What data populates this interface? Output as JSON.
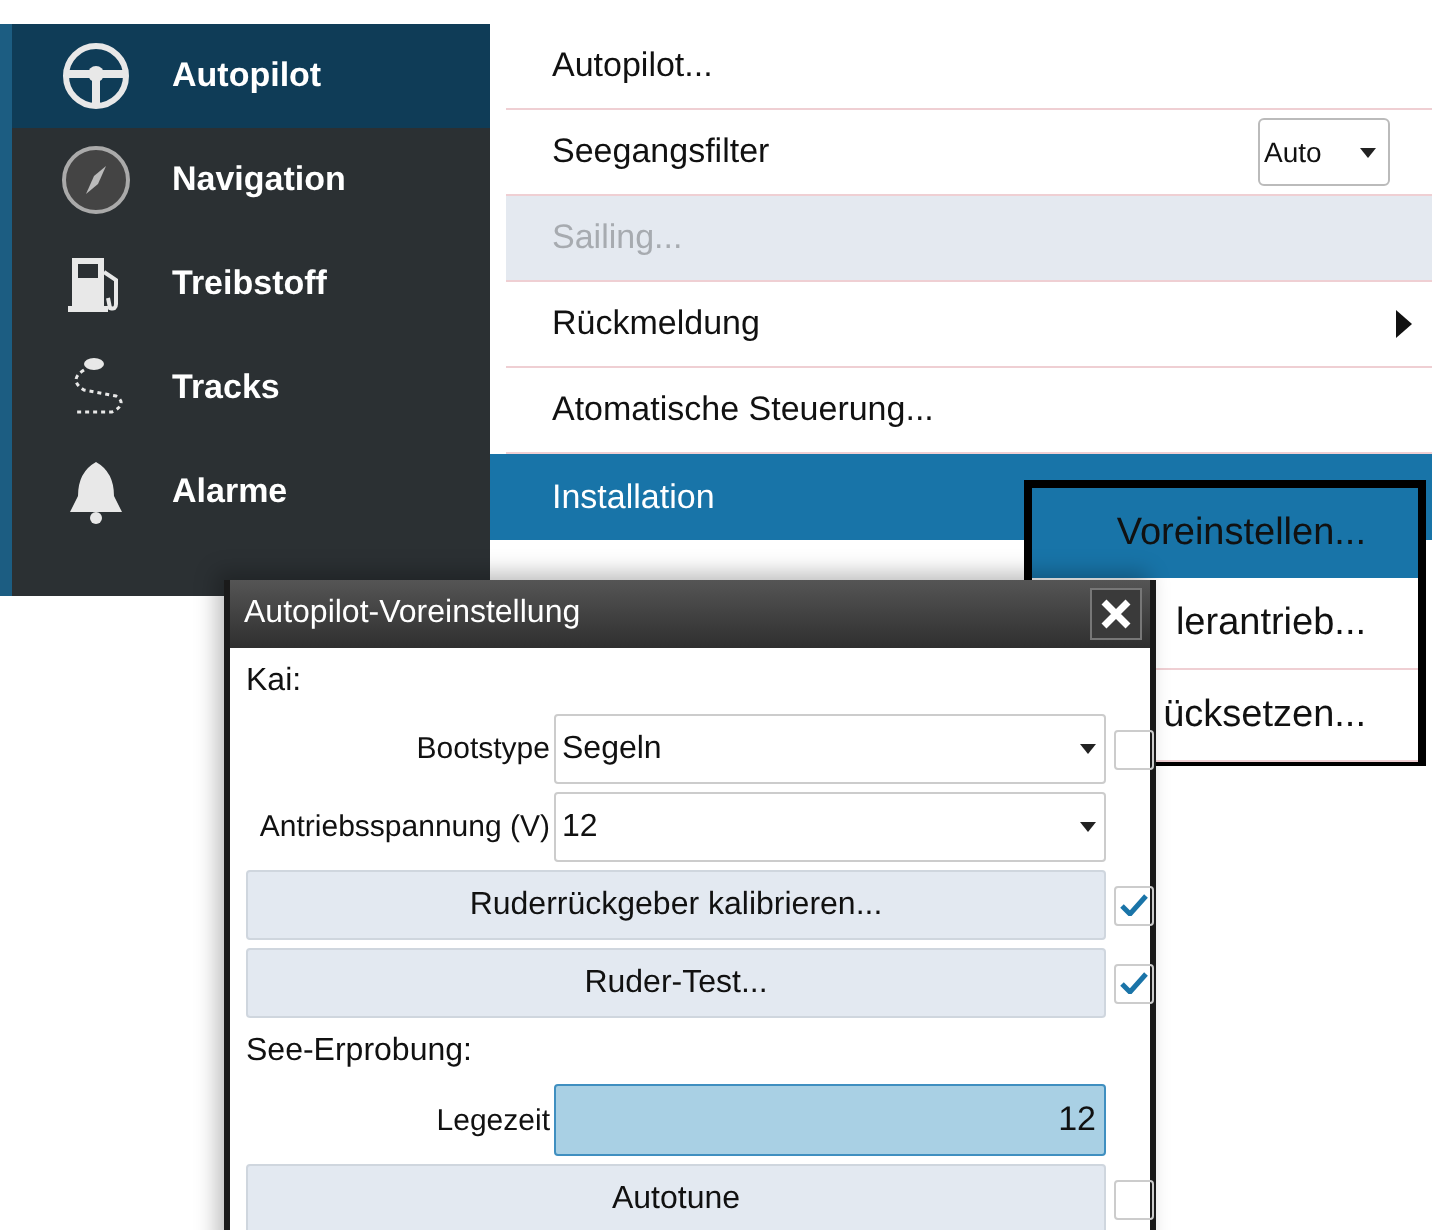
{
  "sidebar": {
    "items": [
      {
        "label": "Autopilot",
        "selected": true
      },
      {
        "label": "Navigation",
        "selected": false
      },
      {
        "label": "Treibstoff",
        "selected": false
      },
      {
        "label": "Tracks",
        "selected": false
      },
      {
        "label": "Alarme",
        "selected": false
      }
    ]
  },
  "menu": {
    "items": [
      {
        "kind": "plain",
        "label": "Autopilot...",
        "selected": false,
        "disabled": false
      },
      {
        "kind": "dropdown",
        "label": "Seegangsfilter",
        "value": "Auto",
        "selected": false,
        "disabled": false
      },
      {
        "kind": "plain",
        "label": "Sailing...",
        "selected": false,
        "disabled": true
      },
      {
        "kind": "submenu",
        "label": "Rückmeldung",
        "selected": false,
        "disabled": false
      },
      {
        "kind": "plain",
        "label": "Atomatische Steuerung...",
        "selected": false,
        "disabled": false
      },
      {
        "kind": "plain",
        "label": "Installation",
        "selected": true,
        "disabled": false
      }
    ]
  },
  "submenu": {
    "items": [
      {
        "label": "Voreinstellen...",
        "selected": true
      },
      {
        "label": "lerantrieb...",
        "selected": false
      },
      {
        "label": "ücksetzen...",
        "selected": false
      }
    ]
  },
  "dialog": {
    "title": "Autopilot-Voreinstellung",
    "rows": [
      {
        "kind": "heading",
        "label": "Kai:"
      },
      {
        "kind": "select",
        "label": "Bootstype",
        "value": "Segeln",
        "checked": false
      },
      {
        "kind": "select",
        "label": "Antriebsspannung (V)",
        "value": "12"
      },
      {
        "kind": "button",
        "label": "Ruderrückgeber kalibrieren...",
        "checked": true
      },
      {
        "kind": "button",
        "label": "Ruder-Test...",
        "checked": true
      },
      {
        "kind": "heading",
        "label": "See-Erprobung:"
      },
      {
        "kind": "field",
        "label": "Legezeit",
        "value": "12",
        "selected": true
      },
      {
        "kind": "button",
        "label": "Autotune",
        "checked": false
      }
    ]
  }
}
